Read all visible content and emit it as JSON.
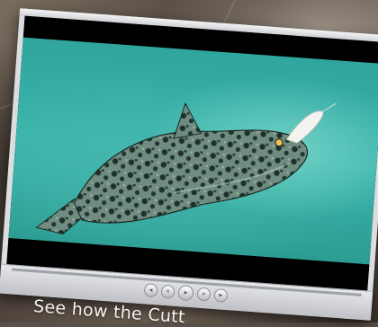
{
  "caption": "See how the Cutt",
  "colors": {
    "water": "#39b4aa",
    "player_frame": "#dcdde0",
    "fish_body": "#3f5a52"
  },
  "icons": [
    "previous-icon",
    "rewind-icon",
    "play-icon",
    "forward-icon",
    "next-icon"
  ]
}
